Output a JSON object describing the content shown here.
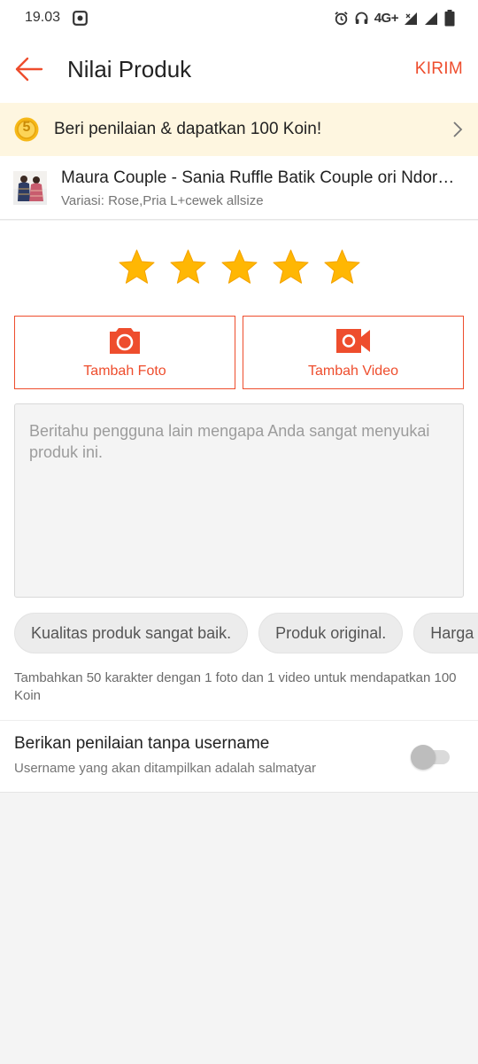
{
  "status_bar": {
    "time": "19.03",
    "network": "4G+"
  },
  "header": {
    "title": "Nilai Produk",
    "submit_label": "KIRIM"
  },
  "coin_banner": {
    "coin_value": "5",
    "text": "Beri penilaian & dapatkan 100 Koin!"
  },
  "product": {
    "name": "Maura Couple - Sania Ruffle Batik Couple ori Ndoro Jowi DNT",
    "variant": "Variasi: Rose,Pria L+cewek allsize"
  },
  "rating": {
    "value": 5,
    "max": 5,
    "star_color": "#ffb703"
  },
  "media": {
    "photo_label": "Tambah Foto",
    "video_label": "Tambah Video"
  },
  "review": {
    "placeholder": "Beritahu pengguna lain mengapa Anda sangat menyukai produk ini.",
    "value": ""
  },
  "chips": [
    "Kualitas produk sangat baik.",
    "Produk original.",
    "Harga terjangkau."
  ],
  "hint": "Tambahkan 50 karakter dengan 1 foto dan 1 video untuk mendapatkan 100 Koin",
  "anonymous": {
    "title": "Berikan penilaian tanpa username",
    "subtitle": "Username yang akan ditampilkan adalah salmatyar",
    "enabled": false
  },
  "colors": {
    "accent": "#ee4d2d",
    "banner_bg": "#fef6e0",
    "coin": "#f6b818"
  }
}
